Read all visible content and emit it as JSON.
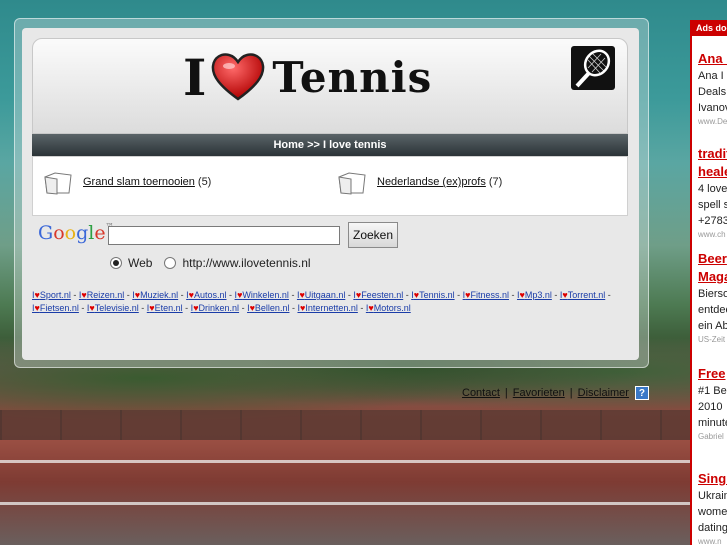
{
  "header": {
    "logo_i": "I",
    "logo_word": "Tennis",
    "breadcrumb": "Home >> I love tennis"
  },
  "categories": [
    {
      "label": "Grand slam toernooien",
      "count": "(5)"
    },
    {
      "label": "Nederlandse (ex)profs",
      "count": "(7)"
    }
  ],
  "search": {
    "logo": "Google",
    "button": "Zoeken",
    "input_value": "",
    "options": [
      {
        "label": "Web",
        "selected": true
      },
      {
        "label": "http://www.ilovetennis.nl",
        "selected": false
      }
    ]
  },
  "links": [
    "I♥Sport.nl",
    "I♥Reizen.nl",
    "I♥Muziek.nl",
    "I♥Autos.nl",
    "I♥Winkelen.nl",
    "I♥Uitgaan.nl",
    "I♥Feesten.nl",
    "I♥Tennis.nl",
    "I♥Fitness.nl",
    "I♥Mp3.nl",
    "I♥Torrent.nl",
    "I♥Fietsen.nl",
    "I♥Televisie.nl",
    "I♥Eten.nl",
    "I♥Drinken.nl",
    "I♥Bellen.nl",
    "I♥Internetten.nl",
    "I♥Motors.nl"
  ],
  "footer": {
    "contact": "Contact",
    "favorieten": "Favorieten",
    "disclaimer": "Disclaimer",
    "help": "?"
  },
  "ads": {
    "header": "Ads doo",
    "items": [
      {
        "title": "Ana I",
        "lines": [
          "Ana I",
          "Deals",
          "Ivanov"
        ],
        "url": "www.De"
      },
      {
        "title": "tradit",
        "title2": "heale",
        "lines": [
          "4 love",
          "spell s",
          "+2783"
        ],
        "url": "www.ch"
      },
      {
        "title": "Beer",
        "title2": "Maga",
        "lines": [
          "Bierso",
          "entdec",
          "ein Ab"
        ],
        "url": "US-Zeit"
      },
      {
        "title": "Free",
        "lines": [
          "#1 Be",
          "2010",
          "minute"
        ],
        "url": "Gabriel"
      },
      {
        "title": "Singl",
        "lines": [
          "Ukrain",
          "wome",
          "dating"
        ],
        "url": "www.n"
      }
    ]
  },
  "colors": {
    "ad_red": "#cc0000",
    "link_blue": "#1a3ca8",
    "navbar": "#2b3337"
  }
}
